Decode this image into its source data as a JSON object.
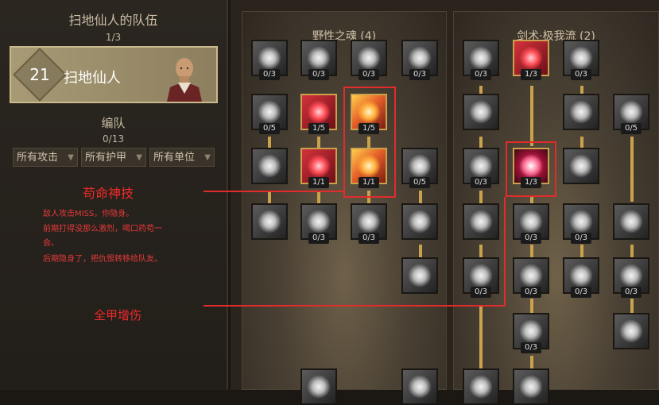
{
  "team": {
    "title": "扫地仙人的队伍",
    "count": "1/3"
  },
  "member": {
    "level": "21",
    "name": "扫地仙人"
  },
  "formation": {
    "title": "编队",
    "count": "0/13"
  },
  "filters": [
    {
      "label": "所有攻击"
    },
    {
      "label": "所有护甲"
    },
    {
      "label": "所有单位"
    }
  ],
  "notes": {
    "title1": "苟命神技",
    "lines": [
      "敌人攻击MISS，你隐身。",
      "前期打得没那么激烈，喝口药苟一",
      "会。",
      "后期隐身了，把仇恨转移给队友。"
    ],
    "title2": "全甲增伤"
  },
  "panels": {
    "left": {
      "title": "野性之魂 (4)"
    },
    "right": {
      "title": "剑术·极我流 (2)"
    }
  },
  "skills": [
    {
      "c": "0/3"
    },
    {
      "c": "0/3"
    },
    {
      "c": "0/3"
    },
    {
      "c": "0/3"
    },
    {
      "c": "0/5"
    },
    {
      "c": "1/5"
    },
    {
      "c": "1/5"
    },
    {
      "c": ""
    },
    {
      "c": "1/1"
    },
    {
      "c": "1/1"
    },
    {
      "c": "0/5"
    },
    {
      "c": ""
    },
    {
      "c": "0/3"
    },
    {
      "c": "0/3"
    },
    {
      "c": ""
    },
    {
      "c": ""
    },
    {
      "c": "0/3"
    },
    {
      "c": "1/3"
    },
    {
      "c": "0/3"
    },
    {
      "c": ""
    },
    {
      "c": ""
    },
    {
      "c": "0/5"
    },
    {
      "c": "0/3"
    },
    {
      "c": "1/3"
    },
    {
      "c": ""
    },
    {
      "c": ""
    },
    {
      "c": "0/3"
    },
    {
      "c": "0/3"
    },
    {
      "c": ""
    },
    {
      "c": "0/3"
    },
    {
      "c": "0/3"
    },
    {
      "c": "0/3"
    },
    {
      "c": "0/3"
    },
    {
      "c": "0/3"
    },
    {
      "c": ""
    },
    {
      "c": ""
    },
    {
      "c": ""
    },
    {
      "c": ""
    },
    {
      "c": ""
    }
  ]
}
